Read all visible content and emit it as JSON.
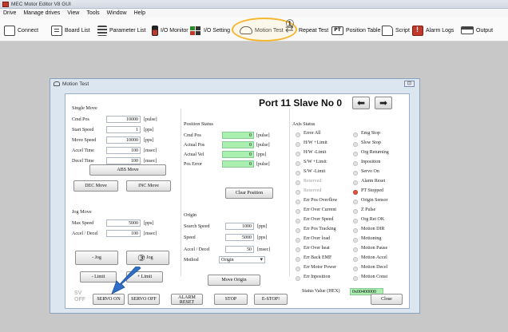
{
  "app": {
    "title": "MEC Motor Editor V8 GUI"
  },
  "menu": [
    "Drive",
    "Manage drives",
    "View",
    "Tools",
    "Window",
    "Help"
  ],
  "toolbar": {
    "connect": "Connect",
    "board_list": "Board List",
    "parameter_list": "Parameter List",
    "io_monitor": "I/O Monitor",
    "io_setting": "I/O Setting",
    "motion_test": "Motion Test",
    "repeat_test": "Repeat Test",
    "position_table": "Position Table",
    "script": "Script",
    "alarm_logs": "Alarm Logs",
    "output": "Output",
    "pt_glyph": "PT"
  },
  "callouts": {
    "one": "①",
    "three": "③"
  },
  "window": {
    "title": "Motion Test",
    "close": "⊡",
    "port_label": "Port 11 Slave No 0",
    "prev": "⬅",
    "next": "➡"
  },
  "single_move": {
    "title": "Single Move",
    "fields": [
      {
        "label": "Cmd Pos",
        "value": "10000",
        "unit": "[pulse]"
      },
      {
        "label": "Start Speed",
        "value": "1",
        "unit": "[pps]"
      },
      {
        "label": "Move Speed",
        "value": "10000",
        "unit": "[pps]"
      },
      {
        "label": "Accel Time",
        "value": "100",
        "unit": "[msec]"
      },
      {
        "label": "Decel Time",
        "value": "100",
        "unit": "[msec]"
      }
    ],
    "abs_move": "ABS Move",
    "dec_move": "DEC Move",
    "inc_move": "INC Move"
  },
  "jog_move": {
    "title": "Jog Move",
    "fields": [
      {
        "label": "Max Speed",
        "value": "5000",
        "unit": "[pps]"
      },
      {
        "label": "Accel / Decel",
        "value": "100",
        "unit": "[msec]"
      }
    ],
    "jog_minus": "- Jog",
    "jog_plus": "+ Jog",
    "limit_minus": "- Limit",
    "limit_plus": "+ Limit"
  },
  "position_status": {
    "title": "Position Status",
    "fields": [
      {
        "label": "Cmd Pos",
        "value": "0",
        "unit": "[pulse]"
      },
      {
        "label": "Actual Pos",
        "value": "0",
        "unit": "[pulse]"
      },
      {
        "label": "Actual Vel",
        "value": "0",
        "unit": "[pps]"
      },
      {
        "label": "Pos Error",
        "value": "0",
        "unit": "[pulse]"
      }
    ],
    "clear": "Clear Position"
  },
  "origin": {
    "title": "Origin",
    "fields": [
      {
        "label": "Search Speed",
        "value": "1000",
        "unit": "[pps]"
      },
      {
        "label": "Speed",
        "value": "5000",
        "unit": "[pps]"
      },
      {
        "label": "Accel / Decel",
        "value": "50",
        "unit": "[msec]"
      }
    ],
    "method_label": "Method",
    "method_value": "Origin",
    "move_origin": "Move Origin"
  },
  "axis_status": {
    "title": "Axis Status",
    "left": [
      {
        "label": "Error All",
        "on": false,
        "dim": false
      },
      {
        "label": "H/W +Limit",
        "on": false,
        "dim": false
      },
      {
        "label": "H/W -Limit",
        "on": false,
        "dim": false
      },
      {
        "label": "S/W +Limit",
        "on": false,
        "dim": false
      },
      {
        "label": "S/W -Limit",
        "on": false,
        "dim": false
      },
      {
        "label": "Reserved",
        "on": false,
        "dim": true
      },
      {
        "label": "Reserved",
        "on": false,
        "dim": true
      },
      {
        "label": "Err Pos Overflow",
        "on": false,
        "dim": false
      },
      {
        "label": "Err Over Current",
        "on": false,
        "dim": false
      },
      {
        "label": "Err Over Speed",
        "on": false,
        "dim": false
      },
      {
        "label": "Err Pos Tracking",
        "on": false,
        "dim": false
      },
      {
        "label": "Err Over load",
        "on": false,
        "dim": false
      },
      {
        "label": "Err Over heat",
        "on": false,
        "dim": false
      },
      {
        "label": "Err Back EMF",
        "on": false,
        "dim": false
      },
      {
        "label": "Err Motor Power",
        "on": false,
        "dim": false
      },
      {
        "label": "Err Inposition",
        "on": false,
        "dim": false
      }
    ],
    "right": [
      {
        "label": "Emg Stop",
        "on": false,
        "dim": false
      },
      {
        "label": "Slow Stop",
        "on": false,
        "dim": false
      },
      {
        "label": "Org Returning",
        "on": false,
        "dim": false
      },
      {
        "label": "Inposition",
        "on": false,
        "dim": false
      },
      {
        "label": "Servo On",
        "on": false,
        "dim": false
      },
      {
        "label": "Alarm Reset",
        "on": false,
        "dim": false
      },
      {
        "label": "PT Stopped",
        "on": true,
        "dim": false
      },
      {
        "label": "Origin Sensor",
        "on": false,
        "dim": false
      },
      {
        "label": "Z Pulse",
        "on": false,
        "dim": false
      },
      {
        "label": "Org Ret OK",
        "on": false,
        "dim": false
      },
      {
        "label": "Motion DIR",
        "on": false,
        "dim": false
      },
      {
        "label": "Motioning",
        "on": false,
        "dim": false
      },
      {
        "label": "Motion Pause",
        "on": false,
        "dim": false
      },
      {
        "label": "Motion Accel",
        "on": false,
        "dim": false
      },
      {
        "label": "Motion Decel",
        "on": false,
        "dim": false
      },
      {
        "label": "Motion Const",
        "on": false,
        "dim": false
      }
    ],
    "status_value_label": "Status Value (HEX)",
    "status_value": "0x00400000"
  },
  "bottom": {
    "sv_line1": "SV",
    "sv_line2": "OFF",
    "servo_on": "SERVO ON",
    "servo_off": "SERVO OFF",
    "alarm_reset_1": "ALARM",
    "alarm_reset_2": "RESET",
    "stop": "STOP",
    "estop": "E-STOP!",
    "close": "Close"
  }
}
